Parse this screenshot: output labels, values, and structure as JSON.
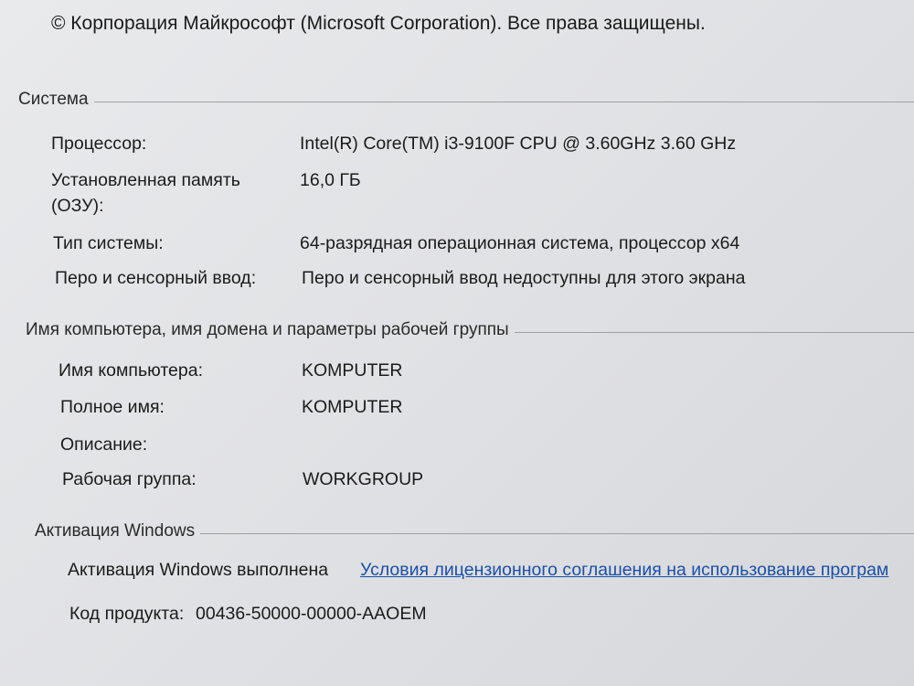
{
  "copyright": "© Корпорация Майкрософт (Microsoft Corporation). Все права защищены.",
  "system": {
    "header": "Система",
    "processor_label": "Процессор:",
    "processor_value": "Intel(R) Core(TM) i3-9100F CPU @ 3.60GHz   3.60 GHz",
    "memory_label_line1": "Установленная память",
    "memory_label_line2": "(ОЗУ):",
    "memory_value": "16,0 ГБ",
    "type_label": "Тип системы:",
    "type_value": "64-разрядная операционная система, процессор x64",
    "pen_label": "Перо и сенсорный ввод:",
    "pen_value": "Перо и сенсорный ввод недоступны для этого экрана"
  },
  "computer": {
    "header": "Имя компьютера, имя домена и параметры рабочей группы",
    "name_label": "Имя компьютера:",
    "name_value": "KOMPUTER",
    "fullname_label": "Полное имя:",
    "fullname_value": "KOMPUTER",
    "description_label": "Описание:",
    "description_value": "",
    "workgroup_label": "Рабочая группа:",
    "workgroup_value": "WORKGROUP"
  },
  "activation": {
    "header": "Активация Windows",
    "status": "Активация Windows выполнена",
    "license_link": "Условия лицензионного соглашения на использование програм",
    "product_key_label": "Код продукта:",
    "product_key_value": "00436-50000-00000-AAOEM"
  }
}
